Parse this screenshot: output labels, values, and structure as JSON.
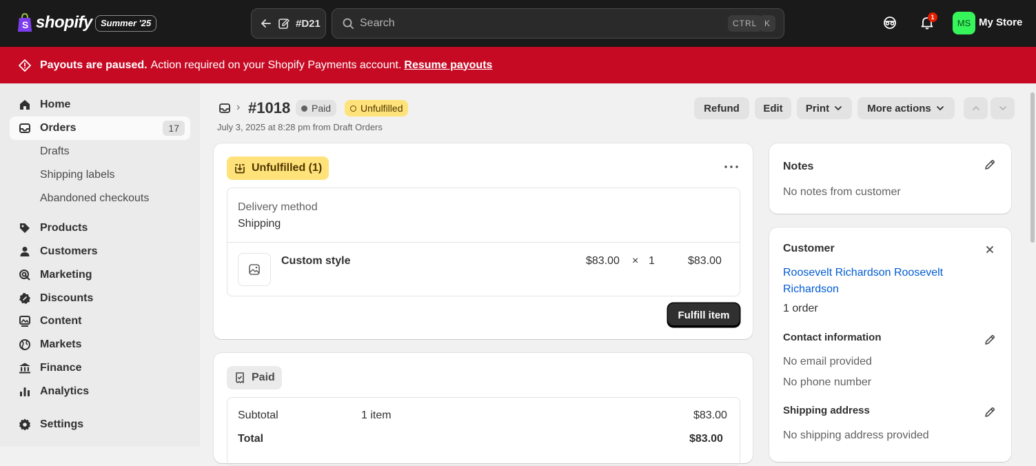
{
  "topbar": {
    "brand": "shopify",
    "edition": "Summer '25",
    "back_label": "#D21",
    "search_placeholder": "Search",
    "kbd_ctrl": "CTRL",
    "kbd_k": "K",
    "notification_count": "1",
    "avatar_initials": "MS",
    "store_name": "My Store"
  },
  "banner": {
    "strong": "Payouts are paused.",
    "message": "Action required on your Shopify Payments account.",
    "link": "Resume payouts"
  },
  "sidebar": {
    "home": "Home",
    "orders": "Orders",
    "orders_count": "17",
    "drafts": "Drafts",
    "shipping_labels": "Shipping labels",
    "abandoned": "Abandoned checkouts",
    "products": "Products",
    "customers": "Customers",
    "marketing": "Marketing",
    "discounts": "Discounts",
    "content": "Content",
    "markets": "Markets",
    "finance": "Finance",
    "analytics": "Analytics",
    "settings": "Settings"
  },
  "order": {
    "title": "#1018",
    "payment_badge": "Paid",
    "fulfillment_badge": "Unfulfilled",
    "meta": "July 3, 2025 at 8:28 pm from Draft Orders",
    "actions": {
      "refund": "Refund",
      "edit": "Edit",
      "print": "Print",
      "more": "More actions"
    }
  },
  "fulfillment_card": {
    "chip": "Unfulfilled (1)",
    "delivery_label": "Delivery method",
    "delivery_value": "Shipping",
    "item_name": "Custom style",
    "item_price": "$83.00",
    "item_times": "×",
    "item_qty": "1",
    "item_total": "$83.00",
    "fulfill_button": "Fulfill item"
  },
  "payment_card": {
    "chip": "Paid",
    "subtotal_label": "Subtotal",
    "subtotal_items": "1 item",
    "subtotal_value": "$83.00",
    "total_label": "Total",
    "total_value": "$83.00"
  },
  "notes_card": {
    "title": "Notes",
    "body": "No notes from customer"
  },
  "customer_card": {
    "title": "Customer",
    "name_line1": "Roosevelt Richardson Roosevelt",
    "name_line2": "Richardson",
    "orders": "1 order",
    "contact_title": "Contact information",
    "email": "No email provided",
    "phone": "No phone number",
    "shipping_title": "Shipping address",
    "shipping_body": "No shipping address provided"
  },
  "colors": {
    "topbar": "#1a1a1a",
    "banner": "#c70a24",
    "unfulfilled_badge": "#ffe27a",
    "link": "#005bd3",
    "avatar": "#36f55a"
  }
}
